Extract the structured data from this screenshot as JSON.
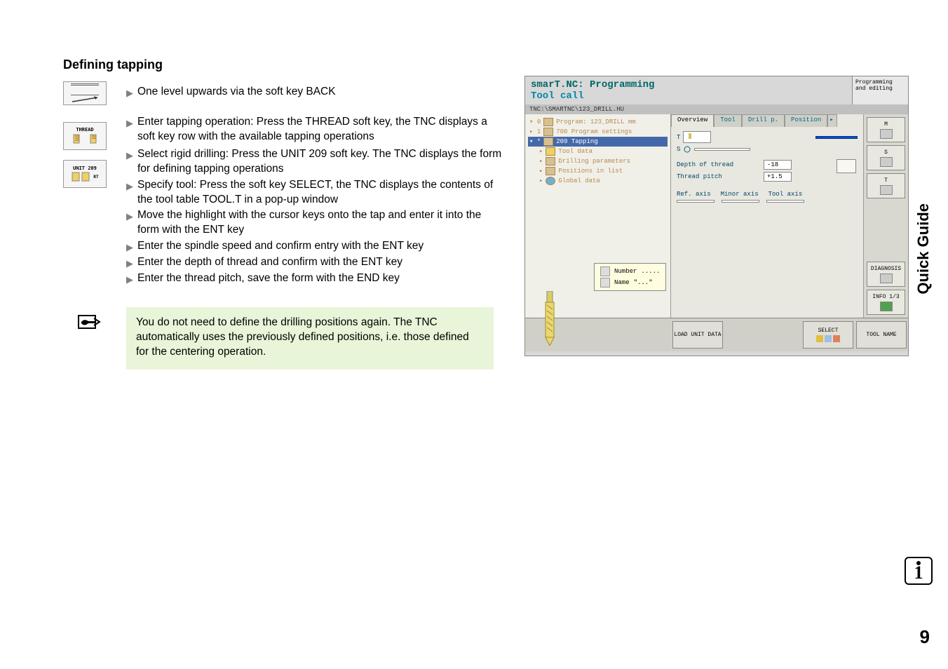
{
  "heading": "Defining tapping",
  "softkeys": {
    "thread_label": "THREAD",
    "unit_label": "UNIT 209",
    "unit_suffix": "RT"
  },
  "bullets": {
    "b1": "One level upwards via the soft key BACK",
    "b2": "Enter tapping operation: Press the THREAD soft key, the TNC displays a soft key row with the available tapping operations",
    "b3": "Select rigid drilling: Press the UNIT 209 soft key. The TNC displays the form for defining tapping operations",
    "b4": "Specify tool: Press the soft key SELECT, the TNC displays the contents of the tool table TOOL.T in a pop-up window",
    "b5": "Move the highlight with the cursor keys onto the tap and enter it into the form with the ENT key",
    "b6": "Enter the spindle speed and confirm entry with the ENT key",
    "b7": "Enter the depth of thread and confirm with the ENT key",
    "b8": "Enter the thread pitch, save the form with the END key"
  },
  "note": "You do not need to define the drilling positions again. The TNC automatically uses the previously defined positions, i.e. those defined for the centering operation.",
  "side_label": "Quick Guide",
  "page_number": "9",
  "screenshot": {
    "title_line1": "smarT.NC: Programming",
    "title_line2": "Tool call",
    "mode": "Programming and editing",
    "path": "TNC:\\SMARTNC\\123_DRILL.HU",
    "tree": {
      "r0_marker": "▾ 0",
      "r0": "Program: 123_DRILL mm",
      "r1_marker": "▸ 1",
      "r1": "700 Program settings",
      "r2_marker": "▾ *",
      "r2": "209 Tapping",
      "r3_marker": "▸",
      "r3": "Tool data",
      "r4_marker": "▸",
      "r4": "Drilling parameters",
      "r5_marker": "▸",
      "r5": "Positions in list",
      "r6_marker": "▸",
      "r6": "Global data"
    },
    "tooltip": {
      "num_label": "Number",
      "num_val": ".....",
      "name_label": "Name",
      "name_val": "\"...\""
    },
    "tabs": {
      "t1": "Overview",
      "t2": "Tool",
      "t3": "Drill p.",
      "t4": "Position"
    },
    "form": {
      "t_label": "T",
      "s_label": "S",
      "depth_label": "Depth of thread",
      "depth_val": "-18",
      "pitch_label": "Thread pitch",
      "pitch_val": "+1.5",
      "refaxis": "Ref. axis",
      "minoraxis": "Minor axis",
      "toolaxis": "Tool axis"
    },
    "sidebar": {
      "m": "M",
      "s": "S",
      "t": "T",
      "diag": "DIAGNOSIS",
      "info": "INFO 1/3"
    },
    "bottom": {
      "load": "LOAD UNIT DATA",
      "select": "SELECT",
      "toolname": "TOOL NAME"
    }
  }
}
